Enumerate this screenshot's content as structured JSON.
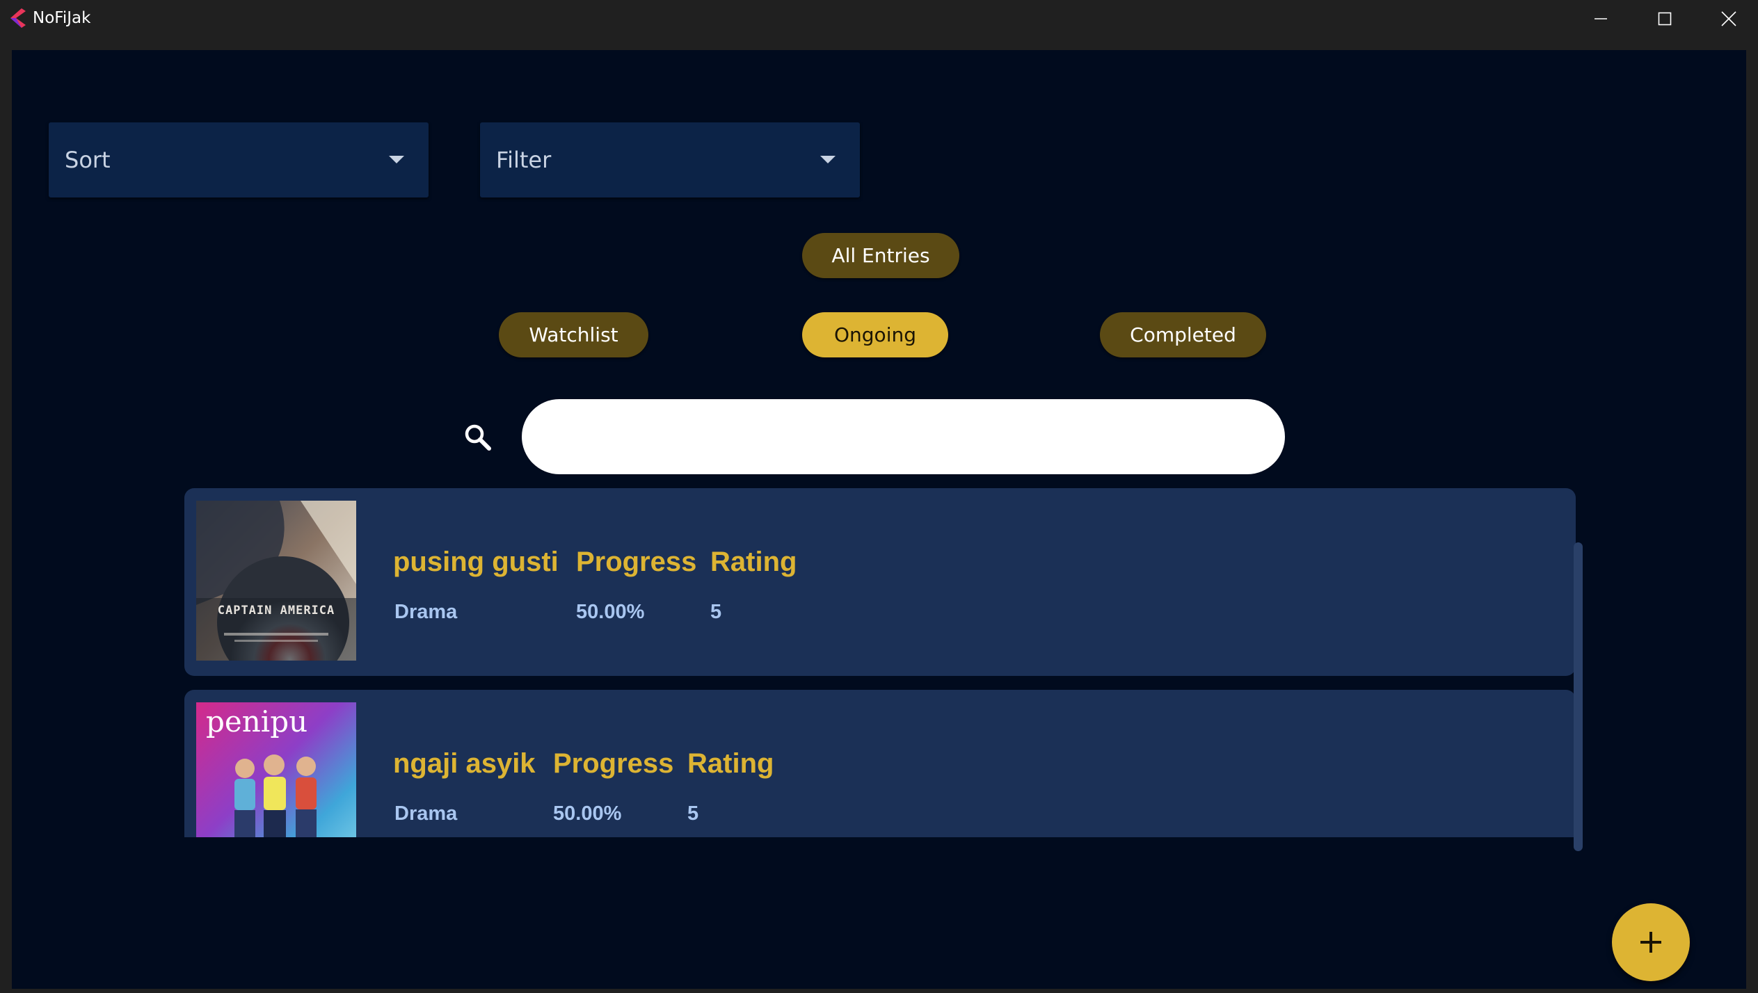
{
  "window": {
    "title": "NoFiJak",
    "controls": [
      "minimize-icon",
      "maximize-icon",
      "close-icon"
    ]
  },
  "dropdowns": {
    "sort": {
      "label": "Sort"
    },
    "filter": {
      "label": "Filter"
    }
  },
  "tabs": {
    "all_entries": "All Entries",
    "watchlist": "Watchlist",
    "ongoing": "Ongoing",
    "completed": "Completed",
    "active": "ongoing"
  },
  "search": {
    "value": "",
    "placeholder": ""
  },
  "entries": [
    {
      "title": "pusing gusti",
      "genre": "Drama",
      "progress_label": "Progress",
      "progress_value": "50.00%",
      "rating_label": "Rating",
      "rating_value": "5",
      "poster_text": "CAPTAIN AMERICA"
    },
    {
      "title": "ngaji asyik",
      "genre": "Drama",
      "progress_label": "Progress",
      "progress_value": "50.00%",
      "rating_label": "Rating",
      "rating_value": "5",
      "poster_text": "penipu"
    }
  ],
  "fab": {
    "icon": "plus-icon"
  },
  "colors": {
    "background": "#010b1e",
    "card": "#1b3056",
    "accent": "#ddb433",
    "accent_dim": "#5b4a14",
    "dropdown": "#0c2347",
    "value_text": "#a9c6f0"
  }
}
